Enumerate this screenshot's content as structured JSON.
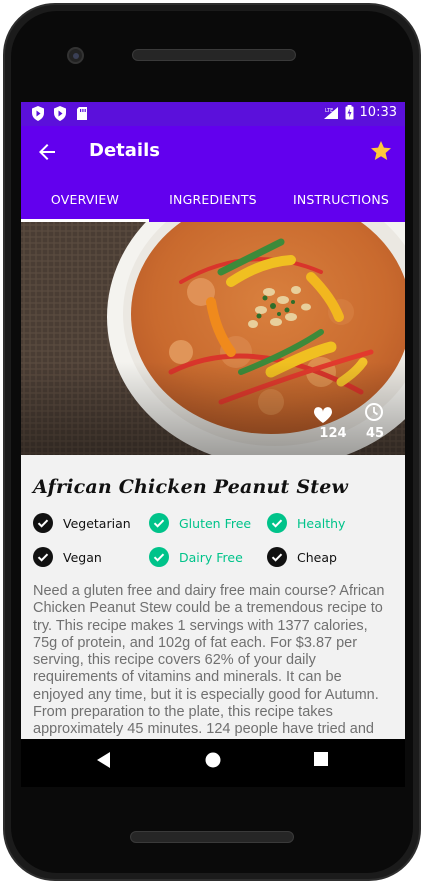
{
  "status_bar": {
    "time": "10:33"
  },
  "app_bar": {
    "title": "Details"
  },
  "tabs": [
    {
      "label": "OVERVIEW"
    },
    {
      "label": "INGREDIENTS"
    },
    {
      "label": "INSTRUCTIONS"
    }
  ],
  "hero": {
    "likes": "124",
    "minutes": "45"
  },
  "recipe": {
    "title": "African Chicken Peanut Stew",
    "tags": [
      {
        "label": "Vegetarian",
        "active": false
      },
      {
        "label": "Gluten Free",
        "active": true
      },
      {
        "label": "Healthy",
        "active": true
      },
      {
        "label": "Vegan",
        "active": false
      },
      {
        "label": "Dairy Free",
        "active": true
      },
      {
        "label": "Cheap",
        "active": false
      }
    ],
    "summary": "Need a gluten free and dairy free main course? African Chicken Peanut Stew could be a tremendous recipe to try. This recipe makes 1 servings with 1377 calories, 75g of protein, and 102g of fat each. For $3.87 per serving, this recipe covers 62% of your daily requirements of vitamins and minerals. It can be enjoyed any time, but it is especially good for Autumn. From preparation to the plate, this recipe takes approximately 45 minutes. 124 people have tried and"
  },
  "colors": {
    "primary": "#6200ee",
    "status_bar": "#5b10db",
    "active_tag": "#00c38a",
    "favorite_star": "#ffc83b"
  }
}
